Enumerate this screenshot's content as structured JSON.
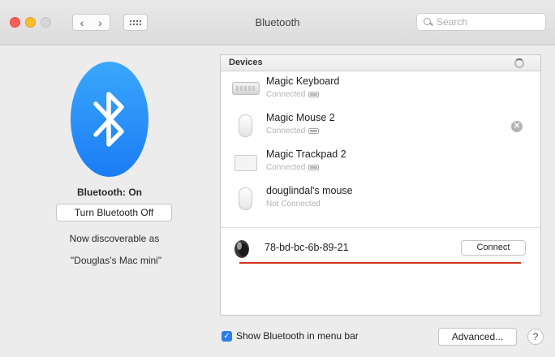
{
  "window": {
    "title": "Bluetooth",
    "back_glyph": "‹",
    "forward_glyph": "›"
  },
  "search": {
    "placeholder": "Search"
  },
  "sidebar": {
    "status": "Bluetooth: On",
    "toggle_label": "Turn Bluetooth Off",
    "discoverable_line": "Now discoverable as",
    "computer_name": "\"Douglas's Mac mini\""
  },
  "devices": {
    "title": "Devices",
    "list": [
      {
        "name": "Magic Keyboard",
        "status": "Connected",
        "icon": "keyboard-icon"
      },
      {
        "name": "Magic Mouse 2",
        "status": "Connected",
        "icon": "mouse-icon"
      },
      {
        "name": "Magic Trackpad 2",
        "status": "Connected",
        "icon": "trackpad-icon"
      },
      {
        "name": "douglindal's mouse",
        "status": "Not Connected",
        "icon": "mouse-icon"
      }
    ],
    "new_device": {
      "name": "78-bd-bc-6b-89-21",
      "icon": "speaker-icon",
      "connect_label": "Connect"
    }
  },
  "footer": {
    "show_in_menu_bar_label": "Show Bluetooth in menu bar",
    "show_in_menu_bar_checked": true,
    "advanced_label": "Advanced...",
    "help_label": "?"
  },
  "colors": {
    "accent": "#2b7de9",
    "bluetooth_blue": "#1b7cf5",
    "underline_red": "#d3341d"
  }
}
